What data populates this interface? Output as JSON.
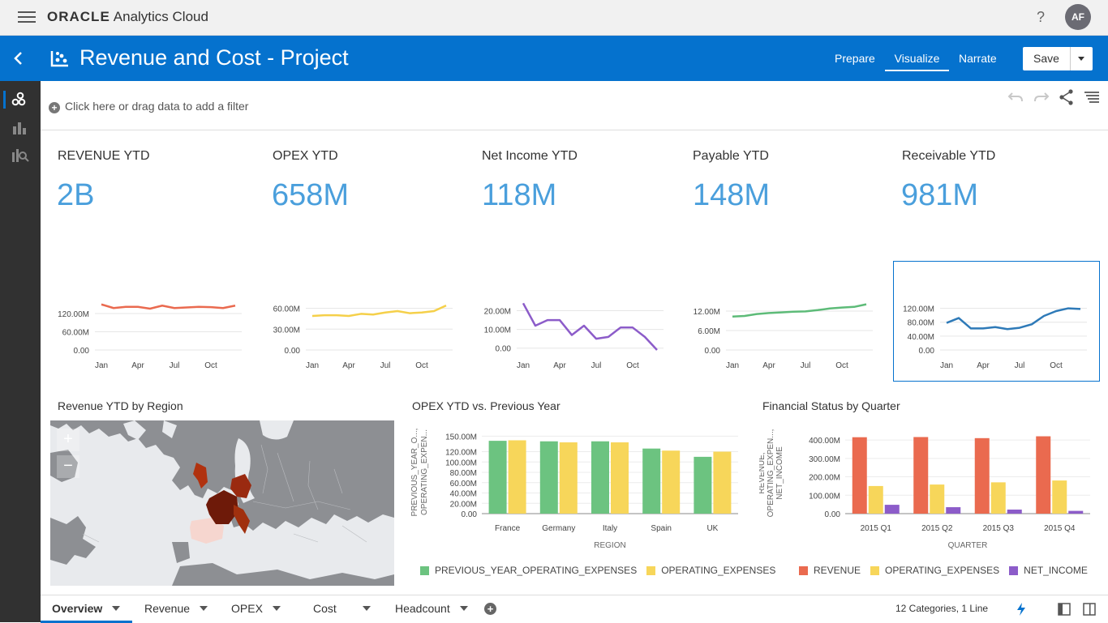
{
  "app": {
    "brand": "ORACLE",
    "product": "Analytics Cloud",
    "help": "?",
    "avatar": "AF"
  },
  "header": {
    "title": "Revenue and Cost - Project",
    "modes": [
      {
        "label": "Prepare"
      },
      {
        "label": "Visualize"
      },
      {
        "label": "Narrate"
      }
    ],
    "active_mode": "Visualize",
    "save_label": "Save",
    "accent": "#0572ce"
  },
  "filterbar": {
    "add_filter": "Click here or drag data to add a filter"
  },
  "kpis": [
    {
      "title": "REVENUE YTD",
      "value": "2B"
    },
    {
      "title": "OPEX YTD",
      "value": "658M"
    },
    {
      "title": "Net Income YTD",
      "value": "118M"
    },
    {
      "title": "Payable YTD",
      "value": "148M"
    },
    {
      "title": "Receivable YTD",
      "value": "981M"
    }
  ],
  "chart_data": [
    {
      "type": "line",
      "name": "Revenue trend",
      "color": "#ea6a4f",
      "x": [
        "Jan",
        "Feb",
        "Mar",
        "Apr",
        "May",
        "Jun",
        "Jul",
        "Aug",
        "Sep",
        "Oct",
        "Nov",
        "Dec"
      ],
      "x_tick_labels": [
        "Jan",
        "Apr",
        "Jul",
        "Oct"
      ],
      "y_ticks": [
        "0.00",
        "60.00M",
        "120.00M"
      ],
      "ylim": [
        0,
        160
      ],
      "values": [
        150,
        138,
        142,
        142,
        136,
        146,
        138,
        140,
        142,
        141,
        138,
        146
      ]
    },
    {
      "type": "line",
      "name": "OPEX trend",
      "color": "#f5d04a",
      "x": [
        "Jan",
        "Feb",
        "Mar",
        "Apr",
        "May",
        "Jun",
        "Jul",
        "Aug",
        "Sep",
        "Oct",
        "Nov",
        "Dec"
      ],
      "x_tick_labels": [
        "Jan",
        "Apr",
        "Jul",
        "Oct"
      ],
      "y_ticks": [
        "0.00",
        "30.00M",
        "60.00M"
      ],
      "ylim": [
        0,
        70
      ],
      "values": [
        49,
        50,
        50,
        49,
        52,
        51,
        54,
        56,
        53,
        54,
        56,
        64
      ]
    },
    {
      "type": "line",
      "name": "Net income trend",
      "color": "#8c5cc9",
      "x": [
        "Jan",
        "Feb",
        "Mar",
        "Apr",
        "May",
        "Jun",
        "Jul",
        "Aug",
        "Sep",
        "Oct",
        "Nov",
        "Dec"
      ],
      "x_tick_labels": [
        "Jan",
        "Apr",
        "Jul",
        "Oct"
      ],
      "y_ticks": [
        "0.00",
        "10.00M",
        "20.00M"
      ],
      "ylim": [
        -1,
        25
      ],
      "values": [
        24,
        12,
        15,
        15,
        7,
        12,
        5,
        6,
        11,
        11,
        6,
        -1
      ]
    },
    {
      "type": "line",
      "name": "Payable trend",
      "color": "#5dbb78",
      "x": [
        "Jan",
        "Feb",
        "Mar",
        "Apr",
        "May",
        "Jun",
        "Jul",
        "Aug",
        "Sep",
        "Oct",
        "Nov",
        "Dec"
      ],
      "x_tick_labels": [
        "Jan",
        "Apr",
        "Jul",
        "Oct"
      ],
      "y_ticks": [
        "0.00",
        "6.00M",
        "12.00M"
      ],
      "ylim": [
        0,
        15
      ],
      "values": [
        10.3,
        10.5,
        11.1,
        11.4,
        11.6,
        11.8,
        11.9,
        12.3,
        12.8,
        13.1,
        13.3,
        14.1
      ]
    },
    {
      "type": "line",
      "name": "Receivable trend",
      "color": "#2e7ab8",
      "x": [
        "Jan",
        "Feb",
        "Mar",
        "Apr",
        "May",
        "Jun",
        "Jul",
        "Aug",
        "Sep",
        "Oct",
        "Nov",
        "Dec"
      ],
      "x_tick_labels": [
        "Jan",
        "Apr",
        "Jul",
        "Oct"
      ],
      "y_ticks": [
        "0.00",
        "40.00M",
        "80.00M",
        "120.00M"
      ],
      "ylim": [
        0,
        140
      ],
      "values": [
        78,
        92,
        62,
        62,
        66,
        60,
        64,
        74,
        98,
        112,
        120,
        118
      ]
    },
    {
      "type": "bar",
      "title": "OPEX YTD vs. Previous Year",
      "categories": [
        "France",
        "Germany",
        "Italy",
        "Spain",
        "UK"
      ],
      "series": [
        {
          "name": "PREVIOUS_YEAR_OPERATING_EXPENSES",
          "color": "#6cc380",
          "values": [
            141,
            140,
            140,
            126,
            110
          ]
        },
        {
          "name": "OPERATING_EXPENSES",
          "color": "#f7d65a",
          "values": [
            142,
            138,
            138,
            122,
            120
          ]
        }
      ],
      "xlabel": "REGION",
      "ylabel": "PREVIOUS_YEAR_O..., OPERATING_EXPEN...",
      "y_ticks": [
        "0.00",
        "20.00M",
        "40.00M",
        "60.00M",
        "80.00M",
        "100.00M",
        "120.00M",
        "150.00M"
      ],
      "ylim": [
        0,
        160
      ]
    },
    {
      "type": "bar",
      "title": "Financial Status by Quarter",
      "categories": [
        "2015 Q1",
        "2015 Q2",
        "2015 Q3",
        "2015 Q4"
      ],
      "series": [
        {
          "name": "REVENUE",
          "color": "#ea6a4f",
          "values": [
            415,
            416,
            410,
            420
          ]
        },
        {
          "name": "OPERATING_EXPENSES",
          "color": "#f7d65a",
          "values": [
            150,
            158,
            170,
            180
          ]
        },
        {
          "name": "NET_INCOME",
          "color": "#8c5cc9",
          "values": [
            48,
            35,
            22,
            15
          ]
        }
      ],
      "xlabel": "QUARTER",
      "ylabel": "REVENUE, OPERATING_EXPEN..., NET_INCOME",
      "y_ticks": [
        "0.00",
        "100.00M",
        "200.00M",
        "300.00M",
        "400.00M"
      ],
      "ylim": [
        0,
        440
      ]
    }
  ],
  "map": {
    "title": "Revenue YTD by Region",
    "zoom_in": "+",
    "zoom_out": "−"
  },
  "bar_titles": {
    "opex": "OPEX YTD vs. Previous Year",
    "fin": "Financial Status by Quarter"
  },
  "canvas_tabs": [
    {
      "label": "Overview"
    },
    {
      "label": "Revenue"
    },
    {
      "label": "OPEX"
    },
    {
      "label": "Cost"
    },
    {
      "label": "Headcount"
    }
  ],
  "status": "12 Categories, 1 Line"
}
